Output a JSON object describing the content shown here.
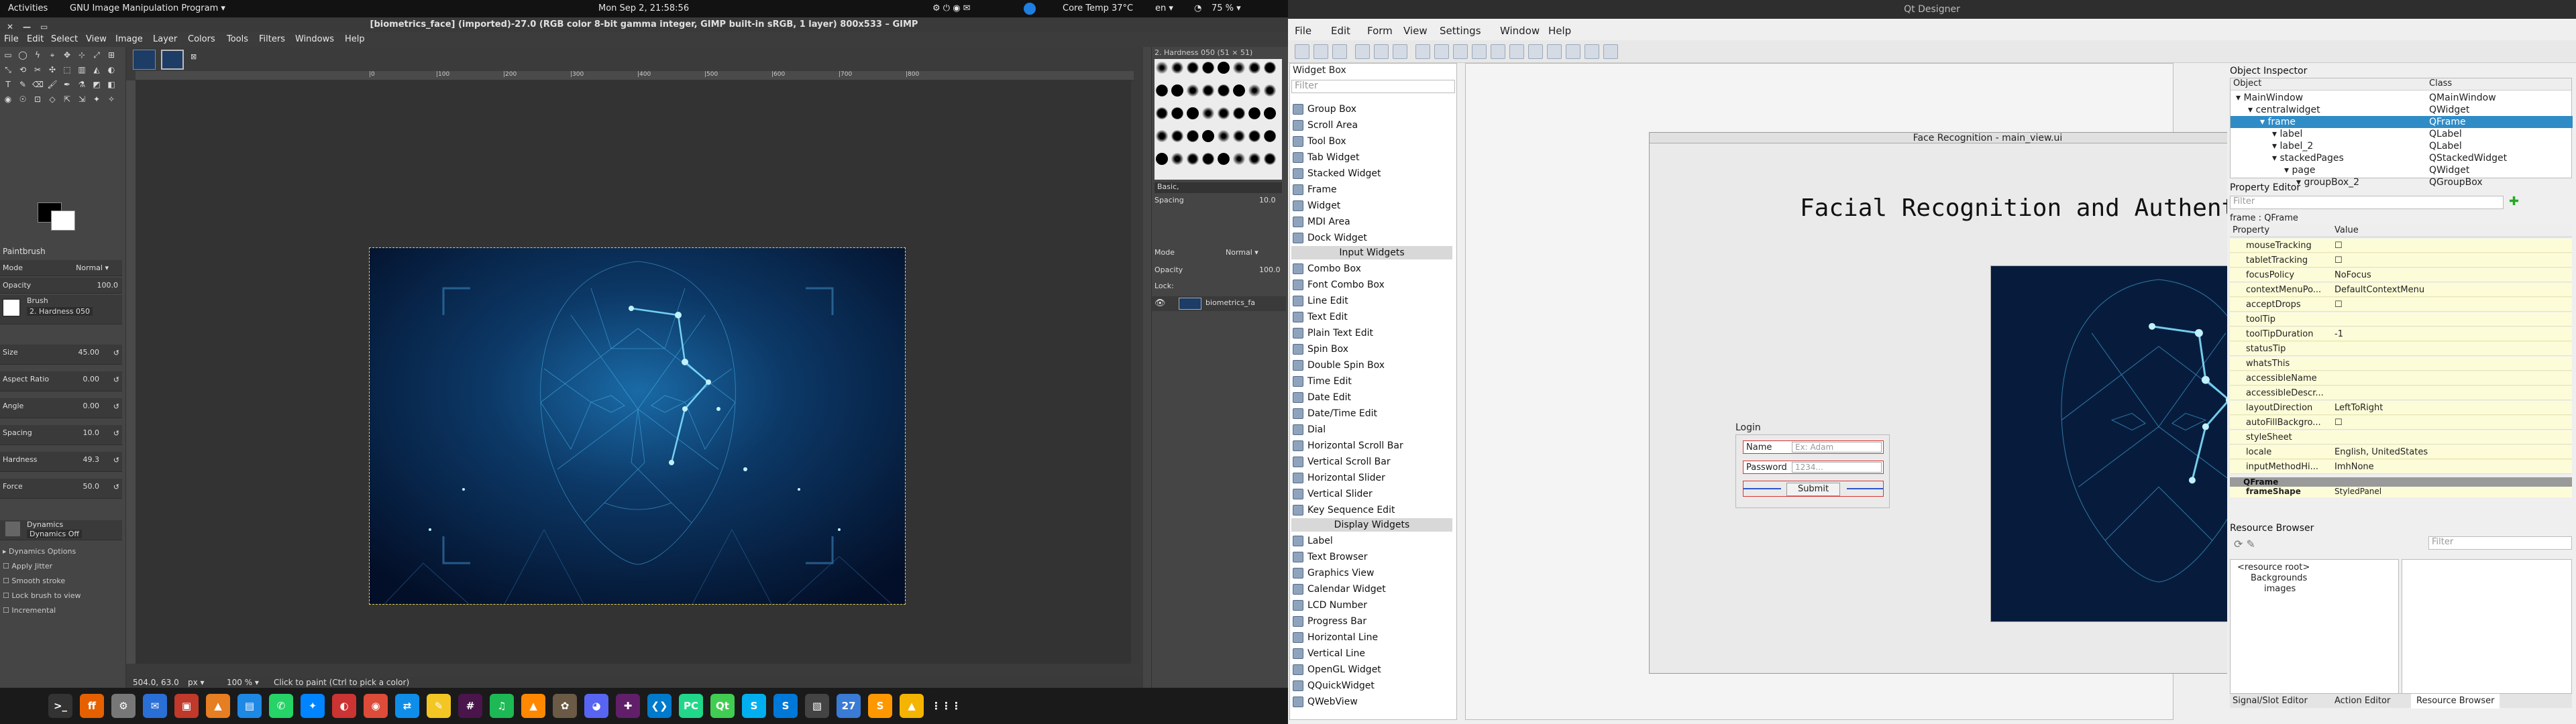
{
  "topbar": {
    "activities": "Activities",
    "app": "GNU Image Manipulation Program ▾",
    "clock": "Mon Sep  2, 21:58:56",
    "sensor": "Core Temp 37°C",
    "lang": "en ▾",
    "battery": "75 % ▾"
  },
  "gimp": {
    "title": "[biometrics_face] (imported)-27.0 (RGB color 8-bit gamma integer, GIMP built-in sRGB, 1 layer) 800x533 – GIMP",
    "menu": [
      "File",
      "Edit",
      "Select",
      "View",
      "Image",
      "Layer",
      "Colors",
      "Tools",
      "Filters",
      "Windows",
      "Help"
    ],
    "tool_name": "Paintbrush",
    "mode_label": "Mode",
    "mode_value": "Normal ▾",
    "opacity_label": "Opacity",
    "opacity_value": "100.0",
    "brush_label": "Brush",
    "brush_value": "2. Hardness 050",
    "options": [
      {
        "label": "Size",
        "value": "45.00"
      },
      {
        "label": "Aspect Ratio",
        "value": "0.00"
      },
      {
        "label": "Angle",
        "value": "0.00"
      },
      {
        "label": "Spacing",
        "value": "10.0"
      },
      {
        "label": "Hardness",
        "value": "49.3"
      },
      {
        "label": "Force",
        "value": "50.0"
      }
    ],
    "dynamics_label": "Dynamics",
    "dynamics_value": "Dynamics Off",
    "checks": [
      "Dynamics Options",
      "Apply Jitter",
      "Smooth stroke",
      "Lock brush to view",
      "Incremental"
    ],
    "status_coords": "504.0, 63.0",
    "status_unit": "px ▾",
    "status_zoom": "100 % ▾",
    "status_msg": "Click to paint (Ctrl to pick a color)",
    "brushes_header": "2. Hardness 050 (51 × 51)",
    "brushes_filter": "Basic,",
    "spacing_label": "Spacing",
    "spacing_value": "10.0",
    "layers_mode_label": "Mode",
    "layers_mode_value": "Normal ▾",
    "layers_opacity_label": "Opacity",
    "layers_opacity_value": "100.0",
    "lock_label": "Lock:",
    "layer_name": "biometrics_fa",
    "ruler_marks": [
      "|0",
      "|100",
      "|200",
      "|300",
      "|400",
      "|500",
      "|600",
      "|700",
      "|800"
    ]
  },
  "taskbar": {
    "icons": [
      {
        "name": "terminal",
        "glyph": ">_",
        "color": "#333"
      },
      {
        "name": "firefox",
        "glyph": "ff",
        "color": "#e66000"
      },
      {
        "name": "settings",
        "glyph": "⚙",
        "color": "#777"
      },
      {
        "name": "thunderbird",
        "glyph": "✉",
        "color": "#2a6fd6"
      },
      {
        "name": "files-red",
        "glyph": "▣",
        "color": "#c0392b"
      },
      {
        "name": "vlc-orange",
        "glyph": "▲",
        "color": "#e67e22"
      },
      {
        "name": "libreoffice",
        "glyph": "▤",
        "color": "#1e88e5"
      },
      {
        "name": "whatsapp",
        "glyph": "✆",
        "color": "#25d366"
      },
      {
        "name": "messenger",
        "glyph": "✦",
        "color": "#0084ff"
      },
      {
        "name": "pdf",
        "glyph": "◐",
        "color": "#cc3333"
      },
      {
        "name": "chrome",
        "glyph": "◉",
        "color": "#dd4b39"
      },
      {
        "name": "teamviewer",
        "glyph": "⇄",
        "color": "#0e8ee9"
      },
      {
        "name": "notes",
        "glyph": "✎",
        "color": "#f3c623"
      },
      {
        "name": "slack",
        "glyph": "#",
        "color": "#4a154b"
      },
      {
        "name": "spotify",
        "glyph": "♫",
        "color": "#1db954"
      },
      {
        "name": "vlc",
        "glyph": "▲",
        "color": "#ff8800"
      },
      {
        "name": "gimp",
        "glyph": "✿",
        "color": "#6b5a45"
      },
      {
        "name": "discord",
        "glyph": "◕",
        "color": "#5865f2"
      },
      {
        "name": "slack2",
        "glyph": "✚",
        "color": "#611f69"
      },
      {
        "name": "vscode",
        "glyph": "❮❯",
        "color": "#007acc"
      },
      {
        "name": "pycharm",
        "glyph": "PC",
        "color": "#21d789"
      },
      {
        "name": "qt",
        "glyph": "Qt",
        "color": "#41cd52"
      },
      {
        "name": "skype-s",
        "glyph": "S",
        "color": "#00aff0"
      },
      {
        "name": "skype",
        "glyph": "S",
        "color": "#0078d7"
      },
      {
        "name": "monitor",
        "glyph": "▧",
        "color": "#444"
      },
      {
        "name": "calendar",
        "glyph": "27",
        "color": "#3a7bd5"
      },
      {
        "name": "sublime",
        "glyph": "S",
        "color": "#ff9800"
      },
      {
        "name": "drive",
        "glyph": "▲",
        "color": "#f4b400"
      },
      {
        "name": "apps",
        "glyph": "⋮⋮⋮",
        "color": "#1a1a1a"
      }
    ]
  },
  "qt": {
    "title": "Qt Designer",
    "menu": [
      "File",
      "Edit",
      "Form",
      "View",
      "Settings",
      "Window",
      "Help"
    ],
    "widget_box_title": "Widget Box",
    "filter_placeholder": "Filter",
    "widget_items_top": [
      "Group Box",
      "Scroll Area",
      "Tool Box",
      "Tab Widget",
      "Stacked Widget",
      "Frame",
      "Widget",
      "MDI Area",
      "Dock Widget"
    ],
    "input_widgets_label": "Input Widgets",
    "input_items": [
      "Combo Box",
      "Font Combo Box",
      "Line Edit",
      "Text Edit",
      "Plain Text Edit",
      "Spin Box",
      "Double Spin Box",
      "Time Edit",
      "Date Edit",
      "Date/Time Edit",
      "Dial",
      "Horizontal Scroll Bar",
      "Vertical Scroll Bar",
      "Horizontal Slider",
      "Vertical Slider",
      "Key Sequence Edit"
    ],
    "display_widgets_label": "Display Widgets",
    "display_items": [
      "Label",
      "Text Browser",
      "Graphics View",
      "Calendar Widget",
      "LCD Number",
      "Progress Bar",
      "Horizontal Line",
      "Vertical Line",
      "OpenGL Widget",
      "QQuickWidget",
      "QWebView"
    ],
    "form_title": "Face Recognition - main_view.ui",
    "heading": "Facial Recognition and Authentication",
    "login_title": "Login",
    "name_label": "Name",
    "name_placeholder": "Ex: Adam",
    "password_label": "Password",
    "password_placeholder": "1234...",
    "submit": "Submit",
    "object_inspector_title": "Object Inspector",
    "oi_col_object": "Object",
    "oi_col_class": "Class",
    "objects": [
      {
        "name": "MainWindow",
        "cls": "QMainWindow",
        "indent": 0,
        "selected": false
      },
      {
        "name": "centralwidget",
        "cls": "QWidget",
        "indent": 1,
        "selected": false
      },
      {
        "name": "frame",
        "cls": "QFrame",
        "indent": 2,
        "selected": true
      },
      {
        "name": "label",
        "cls": "QLabel",
        "indent": 3,
        "selected": false
      },
      {
        "name": "label_2",
        "cls": "QLabel",
        "indent": 3,
        "selected": false
      },
      {
        "name": "stackedPages",
        "cls": "QStackedWidget",
        "indent": 3,
        "selected": false
      },
      {
        "name": "page",
        "cls": "QWidget",
        "indent": 4,
        "selected": false
      },
      {
        "name": "groupBox_2",
        "cls": "QGroupBox",
        "indent": 5,
        "selected": false
      }
    ],
    "property_editor_title": "Property Editor",
    "pe_filter": "Filter",
    "pe_object": "frame : QFrame",
    "pe_col_property": "Property",
    "pe_col_value": "Value",
    "properties": [
      {
        "name": "mouseTracking",
        "value": "☐"
      },
      {
        "name": "tabletTracking",
        "value": "☐"
      },
      {
        "name": "focusPolicy",
        "value": "NoFocus"
      },
      {
        "name": "contextMenuPo...",
        "value": "DefaultContextMenu"
      },
      {
        "name": "acceptDrops",
        "value": "☐"
      },
      {
        "name": "toolTip",
        "value": ""
      },
      {
        "name": "toolTipDuration",
        "value": "-1"
      },
      {
        "name": "statusTip",
        "value": ""
      },
      {
        "name": "whatsThis",
        "value": ""
      },
      {
        "name": "accessibleName",
        "value": ""
      },
      {
        "name": "accessibleDescr...",
        "value": ""
      },
      {
        "name": "layoutDirection",
        "value": "LeftToRight"
      },
      {
        "name": "autoFillBackgro...",
        "value": "☐"
      },
      {
        "name": "styleSheet",
        "value": ""
      },
      {
        "name": "locale",
        "value": "English, UnitedStates"
      },
      {
        "name": "inputMethodHi...",
        "value": "ImhNone"
      }
    ],
    "qframe_section": "QFrame",
    "frame_shape_label": "frameShape",
    "frame_shape_value": "StyledPanel",
    "resource_browser_title": "Resource Browser",
    "rb_filter": "Filter",
    "rb_root": "<resource root>",
    "rb_backgrounds": "Backgrounds",
    "rb_images": "images",
    "bottom_tabs": [
      "Signal/Slot Editor",
      "Action Editor",
      "Resource Browser"
    ]
  }
}
